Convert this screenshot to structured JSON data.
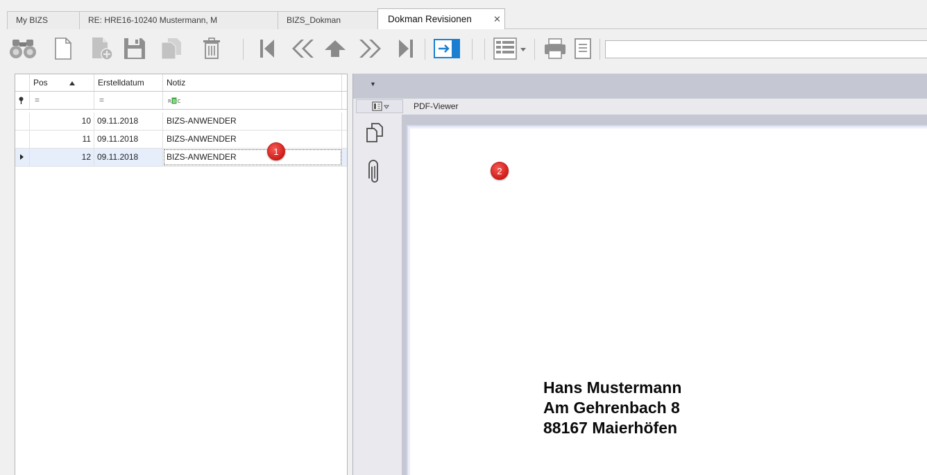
{
  "tabs": [
    {
      "label": "My BIZS",
      "active": false
    },
    {
      "label": "RE: HRE16-10240 Mustermann, M",
      "active": false
    },
    {
      "label": "BIZS_Dokman",
      "active": false
    },
    {
      "label": "Dokman Revisionen",
      "active": true
    }
  ],
  "close_glyph": "✕",
  "toolbar_icons": [
    "binoculars-search-icon",
    "new-document-icon",
    "add-document-icon",
    "save-icon",
    "copy-document-icon",
    "delete-trash-icon",
    "first-record-icon",
    "previous-page-icon",
    "previous-record-icon",
    "next-page-icon",
    "last-record-icon",
    "export-arrow-icon",
    "list-view-icon",
    "print-icon",
    "print-preview-icon"
  ],
  "grid": {
    "columns": [
      "Pos",
      "Erstelldatum",
      "Notiz"
    ],
    "filter_row": {
      "pin": "⚲",
      "pos": "=",
      "date": "=",
      "note": "RBC"
    },
    "rows": [
      {
        "pos": "10",
        "date": "09.11.2018",
        "note": "BIZS-ANWENDER",
        "selected": false
      },
      {
        "pos": "11",
        "date": "09.11.2018",
        "note": "BIZS-ANWENDER",
        "selected": false
      },
      {
        "pos": "12",
        "date": "09.11.2018",
        "note": "BIZS-ANWENDER",
        "selected": true
      }
    ]
  },
  "badges": {
    "one": "1",
    "two": "2"
  },
  "pdf": {
    "collapse_glyph": "▼",
    "tab_label": "PDF-Viewer",
    "side_icons": [
      "pages-thumbnail-icon",
      "attachment-paperclip-icon"
    ],
    "address": [
      "Hans Mustermann",
      "Am Gehrenbach 8",
      "88167 Maierhöfen"
    ]
  },
  "colors": {
    "badge_red": "#d11f1a",
    "selection_row": "#e6eefb",
    "export_blue": "#1a7fd0",
    "pdf_backdrop": "#c5c8d2"
  }
}
